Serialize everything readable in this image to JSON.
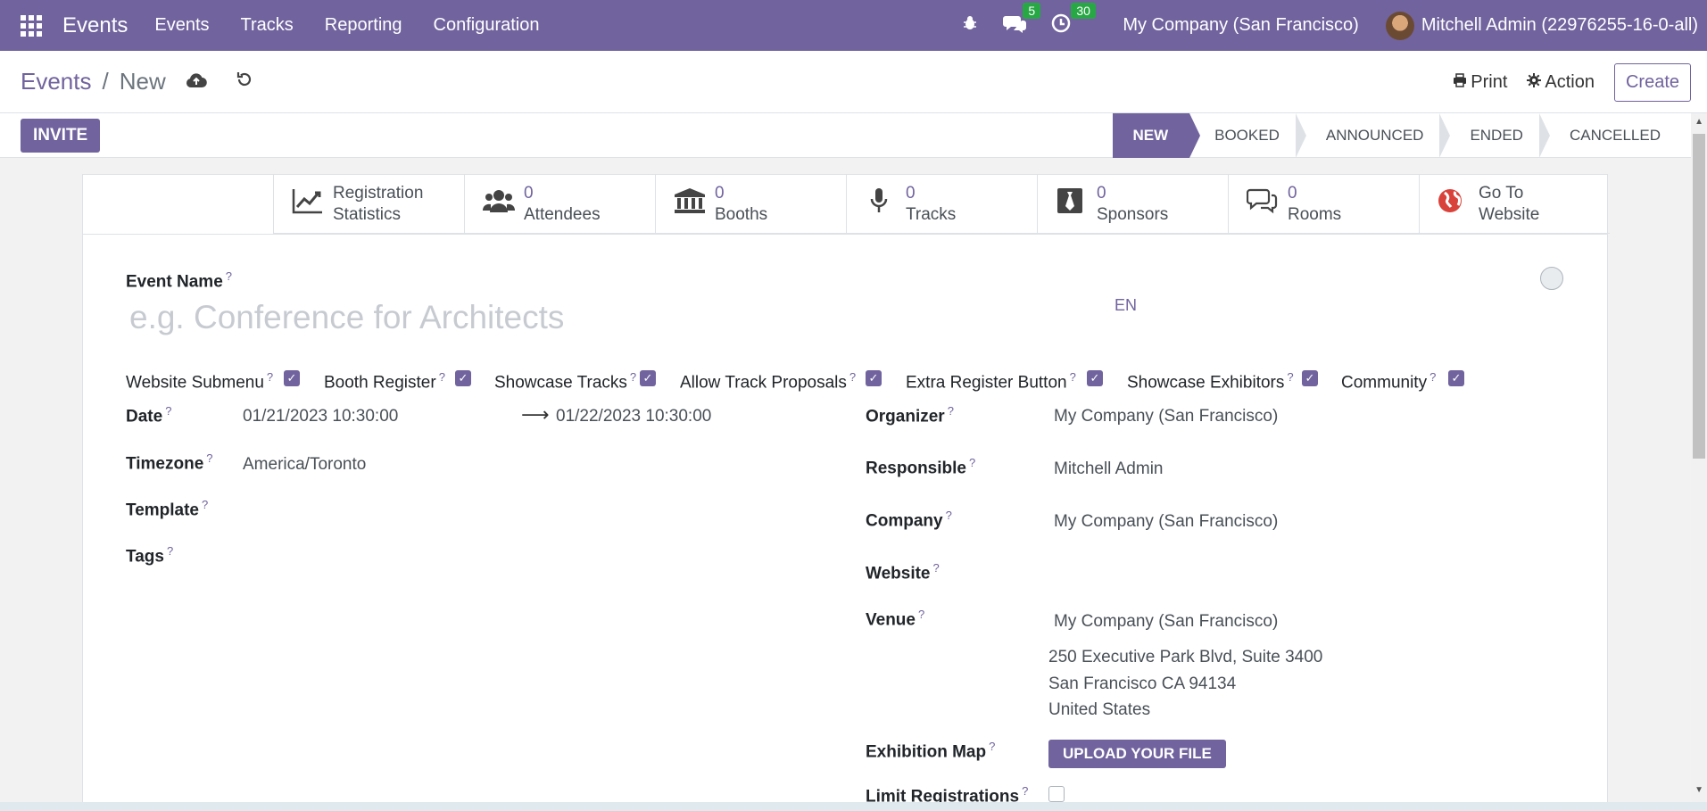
{
  "navbar": {
    "brand": "Events",
    "menu": [
      "Events",
      "Tracks",
      "Reporting",
      "Configuration"
    ],
    "messages_count": "5",
    "activities_count": "30",
    "company": "My Company (San Francisco)",
    "user": "Mitchell Admin (22976255-16-0-all)"
  },
  "breadcrumb": {
    "parent": "Events",
    "current": "New"
  },
  "control": {
    "print": "Print",
    "action": "Action",
    "create": "Create"
  },
  "statusbar": {
    "invite": "INVITE",
    "stages": [
      "NEW",
      "BOOKED",
      "ANNOUNCED",
      "ENDED",
      "CANCELLED"
    ],
    "active_stage": "NEW"
  },
  "smart_buttons": [
    {
      "icon": "chart-line-icon",
      "line1": "Registration",
      "line2": "Statistics"
    },
    {
      "icon": "users-icon",
      "line1": "0",
      "line2": "Attendees"
    },
    {
      "icon": "bank-icon",
      "line1": "0",
      "line2": "Booths"
    },
    {
      "icon": "microphone-icon",
      "line1": "0",
      "line2": "Tracks"
    },
    {
      "icon": "sponsor-tie-icon",
      "line1": "0",
      "line2": "Sponsors"
    },
    {
      "icon": "comments-icon",
      "line1": "0",
      "line2": "Rooms"
    },
    {
      "icon": "globe-icon",
      "line1": "Go To",
      "line2": "Website"
    }
  ],
  "form": {
    "event_name_label": "Event Name",
    "event_name_placeholder": "e.g. Conference for Architects",
    "lang": "EN",
    "checkboxes": [
      {
        "label": "Website Submenu",
        "checked": true
      },
      {
        "label": "Booth Register",
        "checked": true
      },
      {
        "label": "Showcase Tracks",
        "checked": true
      },
      {
        "label": "Allow Track Proposals",
        "checked": true
      },
      {
        "label": "Extra Register Button",
        "checked": true
      },
      {
        "label": "Showcase Exhibitors",
        "checked": true
      },
      {
        "label": "Community",
        "checked": true
      }
    ],
    "date_label": "Date",
    "date_start": "01/21/2023 10:30:00",
    "date_end": "01/22/2023 10:30:00",
    "timezone_label": "Timezone",
    "timezone": "America/Toronto",
    "template_label": "Template",
    "tags_label": "Tags",
    "organizer_label": "Organizer",
    "organizer": "My Company (San Francisco)",
    "responsible_label": "Responsible",
    "responsible": "Mitchell Admin",
    "company_label": "Company",
    "company": "My Company (San Francisco)",
    "website_label": "Website",
    "venue_label": "Venue",
    "venue": "My Company (San Francisco)",
    "venue_address": [
      "250 Executive Park Blvd, Suite 3400",
      "San Francisco CA 94134",
      "United States"
    ],
    "exhibition_map_label": "Exhibition Map",
    "upload_button": "UPLOAD YOUR FILE",
    "limit_registrations_label": "Limit Registrations",
    "limit_registrations_checked": false
  },
  "help_mark": "?",
  "colors": {
    "brand": "#71639e",
    "badge": "#28a745"
  }
}
